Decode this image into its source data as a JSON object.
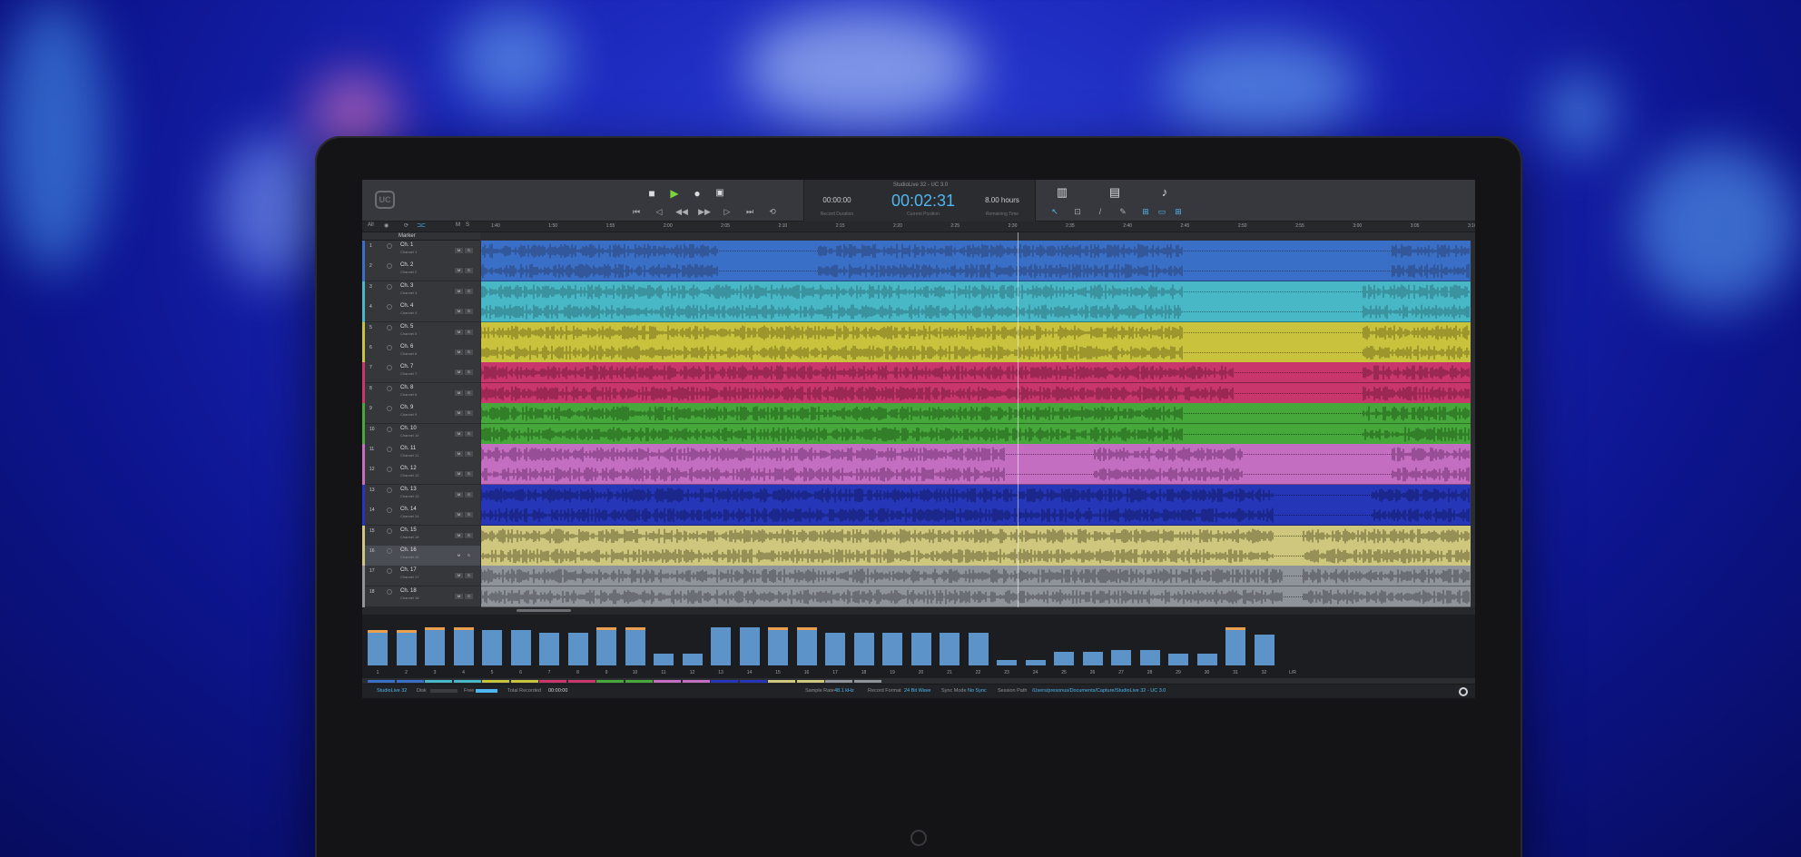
{
  "app": {
    "title": "StudioLive 32 - UC 3.0",
    "logo_icon": "universal-control-logo-icon"
  },
  "transport": {
    "buttons": [
      "stop-icon",
      "play-icon",
      "record-icon",
      "lock-icon"
    ],
    "nav": [
      "skip-back-icon",
      "marker-prev-icon",
      "rewind-icon",
      "fast-forward-icon",
      "marker-next-icon",
      "skip-forward-icon",
      "loop-icon"
    ]
  },
  "clock": {
    "record_duration": "00:00:00",
    "record_duration_label": "Record Duration",
    "current_position": "00:02:31",
    "current_position_label": "Current Position",
    "remaining_time": "8.00 hours",
    "remaining_time_label": "Remaining Time",
    "color": "#4fb6f0"
  },
  "tools": [
    "mixer-icon",
    "save-icon",
    "tuner-icon"
  ],
  "subbar": {
    "all": "All",
    "m": "M",
    "s": "S",
    "marker": "Marker"
  },
  "ruler": [
    "1:40",
    "1:50",
    "1:55",
    "2:00",
    "2:05",
    "2:10",
    "2:15",
    "2:20",
    "2:25",
    "2:30",
    "2:35",
    "2:40",
    "2:45",
    "2:50",
    "2:55",
    "3:00",
    "3:05",
    "3:10"
  ],
  "tracks": [
    {
      "num": "1",
      "name": "Ch. 1",
      "src": "Channel 1",
      "color": "#3a6fc8",
      "wave": "#2a3f6e"
    },
    {
      "num": "2",
      "name": "Ch. 2",
      "src": "Channel 2",
      "color": "#3a6fc8",
      "wave": "#2a3f6e"
    },
    {
      "num": "3",
      "name": "Ch. 3",
      "src": "Channel 3",
      "color": "#48b8c6",
      "wave": "#2b6e78"
    },
    {
      "num": "4",
      "name": "Ch. 4",
      "src": "Channel 4",
      "color": "#48b8c6",
      "wave": "#2b6e78"
    },
    {
      "num": "5",
      "name": "Ch. 5",
      "src": "Channel 5",
      "color": "#c9c23c",
      "wave": "#6f6a1e"
    },
    {
      "num": "6",
      "name": "Ch. 6",
      "src": "Channel 6",
      "color": "#c9c23c",
      "wave": "#6f6a1e"
    },
    {
      "num": "7",
      "name": "Ch. 7",
      "src": "Channel 7",
      "color": "#c8366b",
      "wave": "#6d1b3a"
    },
    {
      "num": "8",
      "name": "Ch. 8",
      "src": "Channel 8",
      "color": "#c8366b",
      "wave": "#6d1b3a"
    },
    {
      "num": "9",
      "name": "Ch. 9",
      "src": "Channel 9",
      "color": "#46a83a",
      "wave": "#1f5418"
    },
    {
      "num": "10",
      "name": "Ch. 10",
      "src": "Channel 10",
      "color": "#46a83a",
      "wave": "#1f5418"
    },
    {
      "num": "11",
      "name": "Ch. 11",
      "src": "Channel 11",
      "color": "#c46ec2",
      "wave": "#6b2f6a"
    },
    {
      "num": "12",
      "name": "Ch. 12",
      "src": "Channel 12",
      "color": "#c46ec2",
      "wave": "#6b2f6a"
    },
    {
      "num": "13",
      "name": "Ch. 13",
      "src": "Channel 13",
      "color": "#2636b8",
      "wave": "#10185e"
    },
    {
      "num": "14",
      "name": "Ch. 14",
      "src": "Channel 14",
      "color": "#2636b8",
      "wave": "#10185e"
    },
    {
      "num": "15",
      "name": "Ch. 15",
      "src": "Channel 15",
      "color": "#cfc77e",
      "wave": "#5e5a30"
    },
    {
      "num": "16",
      "name": "Ch. 16",
      "src": "Channel 16",
      "color": "#cfc77e",
      "wave": "#5e5a30"
    },
    {
      "num": "17",
      "name": "Ch. 17",
      "src": "Channel 17",
      "color": "#8f939a",
      "wave": "#45484d"
    },
    {
      "num": "18",
      "name": "Ch. 18",
      "src": "Channel 18",
      "color": "#8f939a",
      "wave": "#45484d"
    }
  ],
  "track_buttons": {
    "mute": "M",
    "solo": "S"
  },
  "meters": {
    "levels": [
      0.75,
      0.75,
      0.8,
      0.8,
      0.75,
      0.75,
      0.7,
      0.7,
      0.8,
      0.8,
      0.25,
      0.25,
      0.8,
      0.8,
      0.8,
      0.8,
      0.7,
      0.7,
      0.7,
      0.7,
      0.7,
      0.7,
      0.12,
      0.12,
      0.28,
      0.28,
      0.33,
      0.33,
      0.25,
      0.25,
      0.8,
      0.65
    ],
    "peaks": [
      true,
      true,
      true,
      true,
      false,
      false,
      false,
      false,
      true,
      true,
      false,
      false,
      false,
      false,
      true,
      true,
      false,
      false,
      false,
      false,
      false,
      false,
      false,
      false,
      false,
      false,
      false,
      false,
      false,
      false,
      true,
      false
    ],
    "labels": [
      "1",
      "2",
      "3",
      "4",
      "5",
      "6",
      "7",
      "8",
      "9",
      "10",
      "11",
      "12",
      "13",
      "14",
      "15",
      "16",
      "17",
      "18",
      "19",
      "20",
      "21",
      "22",
      "23",
      "24",
      "25",
      "26",
      "27",
      "28",
      "29",
      "30",
      "31",
      "32"
    ],
    "master_label": "L/R"
  },
  "status": {
    "device": "StudioLive 32",
    "disk_label": "Disk",
    "free_label": "Free",
    "total_recorded_label": "Total Recorded",
    "total_recorded": "00:00:00",
    "sample_rate_label": "Sample Rate",
    "sample_rate": "48.1 kHz",
    "record_format_label": "Record Format",
    "record_format": "24 Bit Wave",
    "sync_mode_label": "Sync Mode",
    "sync_mode": "No Sync",
    "session_path_label": "Session Path",
    "session_path": "/Users/presonus/Documents/Capture/StudioLive 32 - UC 3.0",
    "settings_icon": "gear-icon"
  }
}
